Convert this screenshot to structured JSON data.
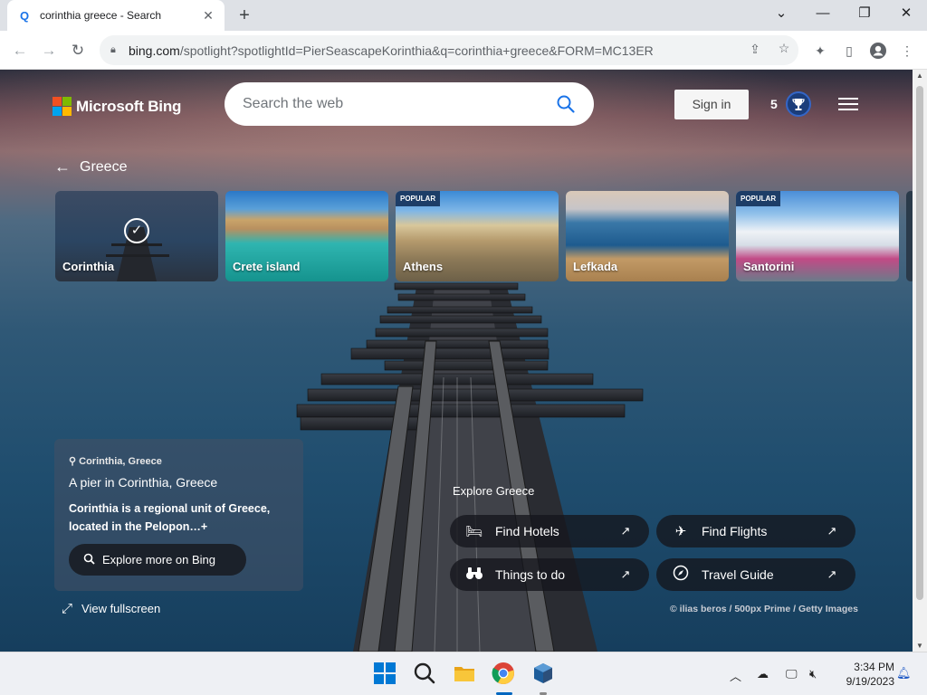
{
  "browser": {
    "tab_title": "corinthia greece - Search",
    "tab_favicon": "Q",
    "tab_close": "✕",
    "new_tab": "+",
    "url_host": "bing.com",
    "url_rest": "/spotlight?spotlightId=PierSeascapeKorinthia&q=corinthia+greece&FORM=MC13ER"
  },
  "header": {
    "brand": "Microsoft Bing",
    "search_placeholder": "Search the web",
    "sign_in": "Sign in",
    "points": "5"
  },
  "breadcrumb": {
    "back_label": "Greece"
  },
  "carousel": [
    {
      "label": "Corinthia",
      "badge": "",
      "selected": true
    },
    {
      "label": "Crete island",
      "badge": "",
      "selected": false
    },
    {
      "label": "Athens",
      "badge": "POPULAR",
      "selected": false
    },
    {
      "label": "Lefkada",
      "badge": "",
      "selected": false
    },
    {
      "label": "Santorini",
      "badge": "POPULAR",
      "selected": false
    }
  ],
  "info": {
    "location": "Corinthia, Greece",
    "headline": "A pier in Corinthia, Greece",
    "description": "Corinthia is a regional unit of Greece, located in the Pelopon…",
    "expand": "+",
    "explore_button": "Explore more on Bing",
    "fullscreen": "View fullscreen"
  },
  "explore": {
    "title": "Explore Greece",
    "links": [
      {
        "label": "Find Hotels",
        "icon": "bed-icon"
      },
      {
        "label": "Find Flights",
        "icon": "plane-icon"
      },
      {
        "label": "Things to do",
        "icon": "binoculars-icon"
      },
      {
        "label": "Travel Guide",
        "icon": "compass-icon"
      }
    ]
  },
  "credit": "© ilias beros / 500px Prime / Getty Images",
  "taskbar": {
    "time": "3:34 PM",
    "date": "9/19/2023"
  },
  "colors": {
    "ms_red": "#f25022",
    "ms_green": "#7fba00",
    "ms_blue": "#00a4ef",
    "ms_yellow": "#ffb900",
    "bing_blue": "#1a73e8"
  }
}
